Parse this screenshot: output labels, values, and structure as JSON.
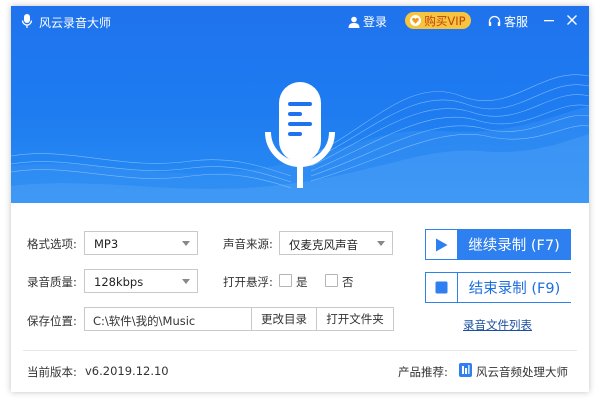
{
  "app": {
    "title": "风云录音大师"
  },
  "header": {
    "login_label": "登录",
    "vip_label": "购买VIP",
    "service_label": "客服"
  },
  "settings": {
    "format_label": "格式选项:",
    "format_value": "MP3",
    "quality_label": "录音质量:",
    "quality_value": "128kbps",
    "source_label": "声音来源:",
    "source_value": "仅麦克风声音",
    "float_label": "打开悬浮:",
    "float_yes": "是",
    "float_no": "否",
    "save_label": "保存位置:",
    "save_path": "C:\\软件\\我的\\Music",
    "change_dir_label": "更改目录",
    "open_folder_label": "打开文件夹"
  },
  "recording": {
    "continue_label": "继续录制 (F7)",
    "stop_label": "结束录制 (F9)",
    "list_label": "录音文件列表"
  },
  "footer": {
    "version_label": "当前版本:",
    "version_value": "v6.2019.12.10",
    "recommend_label": "产品推荐:",
    "recommend_product": "风云音频处理大师"
  },
  "colors": {
    "hero_blue": "#1f73ee",
    "accent_blue": "#2e7ff0",
    "vip_gold": "#f7c440"
  },
  "icons": {
    "app_logo": "microphone-icon",
    "login": "user-icon",
    "vip": "heart-icon",
    "service": "headset-icon",
    "continue": "play-icon",
    "stop": "stop-icon"
  }
}
